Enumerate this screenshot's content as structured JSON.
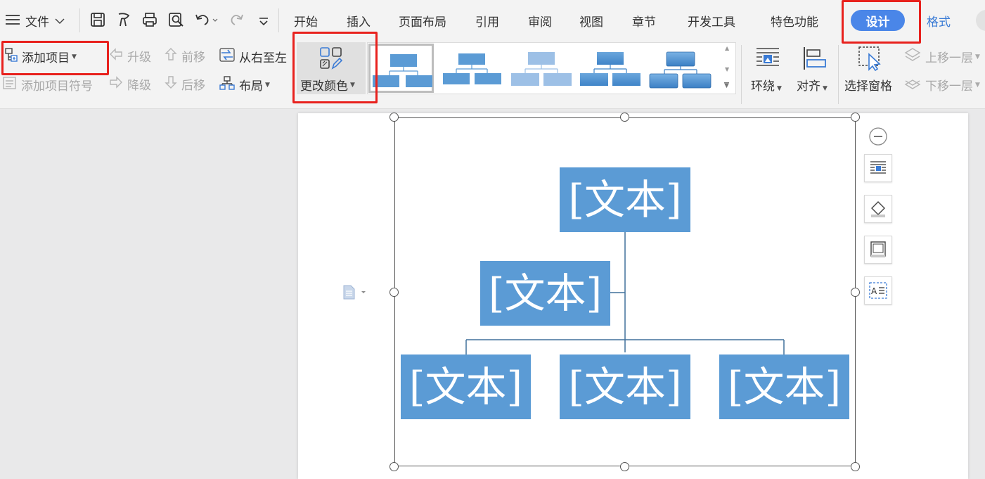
{
  "menubar": {
    "file_label": "文件",
    "tabs": [
      "开始",
      "插入",
      "页面布局",
      "引用",
      "审阅",
      "视图",
      "章节",
      "开发工具",
      "特色功能"
    ],
    "design_label": "设计",
    "format_label": "格式"
  },
  "ribbon": {
    "add_item": "添加项目",
    "add_item_bullet": "添加项目符号",
    "promote": "升级",
    "demote": "降级",
    "move_forward": "前移",
    "move_backward": "后移",
    "right_to_left": "从右至左",
    "layout": "布局",
    "change_color": "更改颜色",
    "wrap": "环绕",
    "align": "对齐",
    "selection_pane": "选择窗格",
    "bring_forward": "上移一层",
    "send_backward": "下移一层"
  },
  "smartart": {
    "nodes": [
      "[文本]",
      "[文本]",
      "[文本]",
      "[文本]",
      "[文本]"
    ]
  },
  "colors": {
    "accent": "#5b9bd5",
    "highlight": "#e8211d",
    "design_pill": "#4a86e8"
  }
}
